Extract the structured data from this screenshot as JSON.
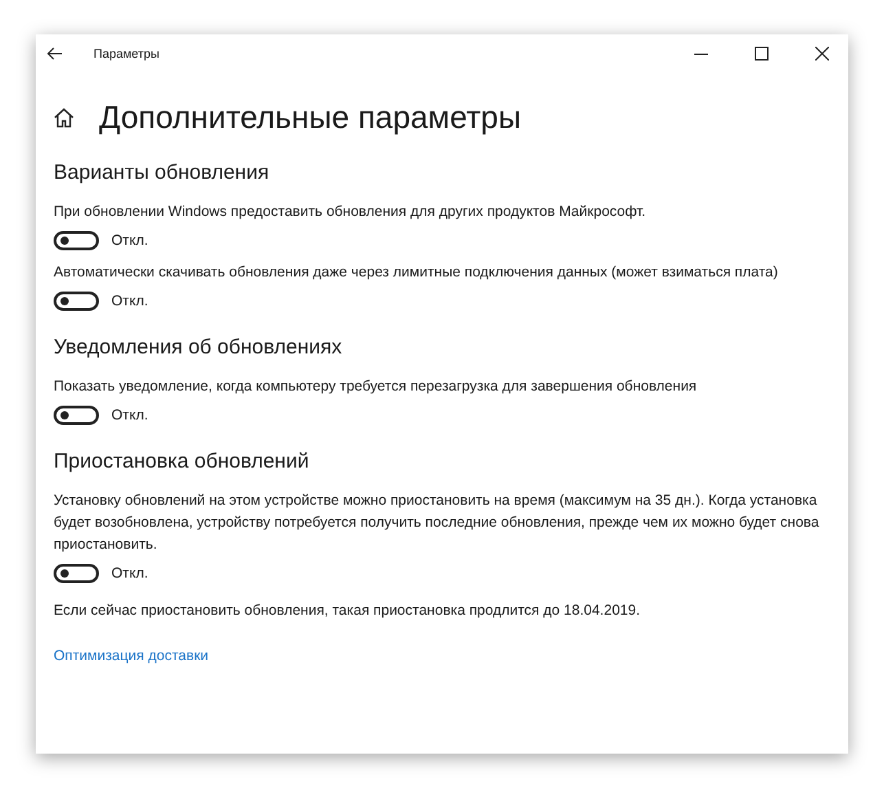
{
  "window": {
    "title": "Параметры"
  },
  "page_title": "Дополнительные параметры",
  "sections": [
    {
      "title": "Варианты обновления",
      "items": [
        {
          "kind": "toggle",
          "label": "При обновлении Windows предоставить обновления для других продуктов Майкрософт.",
          "on": false,
          "state_text": "Откл."
        },
        {
          "kind": "toggle",
          "label": "Автоматически скачивать обновления даже через лимитные подключения данных (может взиматься плата)",
          "on": false,
          "state_text": "Откл."
        }
      ]
    },
    {
      "title": "Уведомления об обновлениях",
      "items": [
        {
          "kind": "toggle",
          "label": "Показать уведомление, когда компьютеру требуется перезагрузка для завершения обновления",
          "on": false,
          "state_text": "Откл."
        }
      ]
    },
    {
      "title": "Приостановка обновлений",
      "items": [
        {
          "kind": "toggle",
          "label": "Установку обновлений на этом устройстве можно приостановить на время (максимум на 35 дн.). Когда установка будет возобновлена, устройству потребуется получить последние обновления, прежде чем их можно будет снова приостановить.",
          "on": false,
          "state_text": "Откл."
        },
        {
          "kind": "note",
          "text": "Если сейчас приостановить обновления, такая приостановка продлится до 18.04.2019."
        }
      ]
    }
  ],
  "link": "Оптимизация доставки"
}
